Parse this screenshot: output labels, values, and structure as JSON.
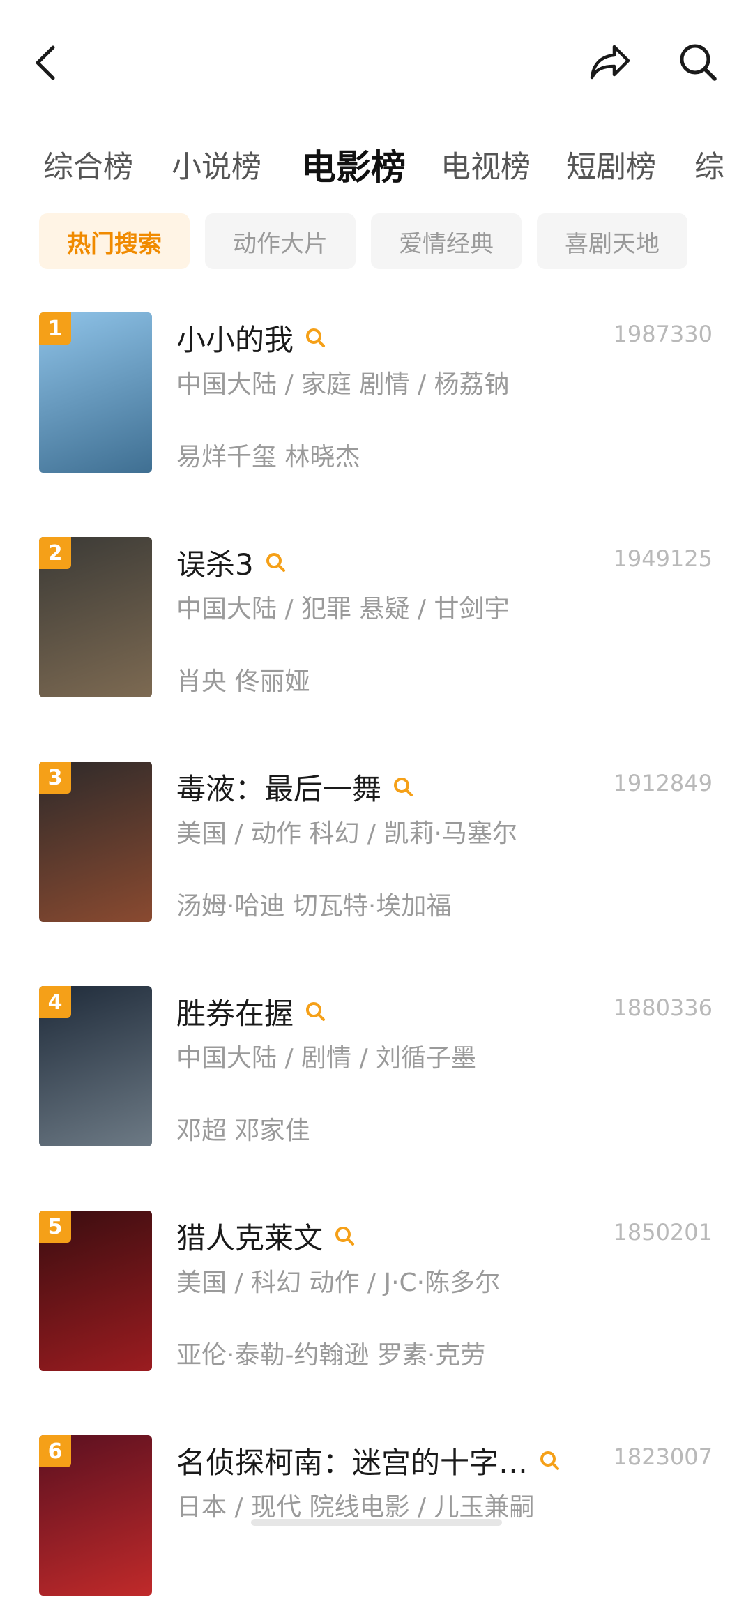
{
  "header": {
    "back_icon": "chevron-left-icon",
    "share_icon": "share-arrow-icon",
    "search_icon": "search-icon"
  },
  "tabs": [
    {
      "label": "综合榜",
      "active": false
    },
    {
      "label": "小说榜",
      "active": false
    },
    {
      "label": "电影榜",
      "active": true
    },
    {
      "label": "电视榜",
      "active": false
    },
    {
      "label": "短剧榜",
      "active": false
    },
    {
      "label": "综",
      "active": false
    }
  ],
  "chips": [
    {
      "label": "热门搜索",
      "active": true
    },
    {
      "label": "动作大片",
      "active": false
    },
    {
      "label": "爱情经典",
      "active": false
    },
    {
      "label": "喜剧天地",
      "active": false
    }
  ],
  "accent_color": "#f5a018",
  "items": [
    {
      "rank": "1",
      "title": "小小的我",
      "count": "1987330",
      "meta": "中国大陆 / 家庭 剧情 / 杨荔钠",
      "cast": "易烊千玺 林晓杰",
      "poster_colors": [
        "#8fc3e8",
        "#3f6f92"
      ]
    },
    {
      "rank": "2",
      "title": "误杀3",
      "count": "1949125",
      "meta": "中国大陆 / 犯罪 悬疑 / 甘剑宇",
      "cast": "肖央 佟丽娅",
      "poster_colors": [
        "#3b3a36",
        "#7d6a52"
      ]
    },
    {
      "rank": "3",
      "title": "毒液：最后一舞",
      "count": "1912849",
      "meta": "美国 / 动作 科幻 / 凯莉·马塞尔",
      "cast": "汤姆·哈迪  切瓦特·埃加福",
      "poster_colors": [
        "#2e2a2a",
        "#8a4a30"
      ]
    },
    {
      "rank": "4",
      "title": "胜券在握",
      "count": "1880336",
      "meta": "中国大陆 / 剧情 / 刘循子墨",
      "cast": "邓超 邓家佳",
      "poster_colors": [
        "#1f2b3a",
        "#6d7a85"
      ]
    },
    {
      "rank": "5",
      "title": "猎人克莱文",
      "count": "1850201",
      "meta": "美国 / 科幻 动作 / J·C·陈多尔",
      "cast": "亚伦·泰勒-约翰逊 罗素·克劳",
      "poster_colors": [
        "#3a0d10",
        "#9b1c20"
      ]
    },
    {
      "rank": "6",
      "title": "名侦探柯南：迷宫的十字…",
      "count": "1823007",
      "meta": "日本 / 现代 院线电影 / 儿玉兼嗣",
      "cast": "",
      "poster_colors": [
        "#5a1020",
        "#c02a2a"
      ]
    }
  ]
}
